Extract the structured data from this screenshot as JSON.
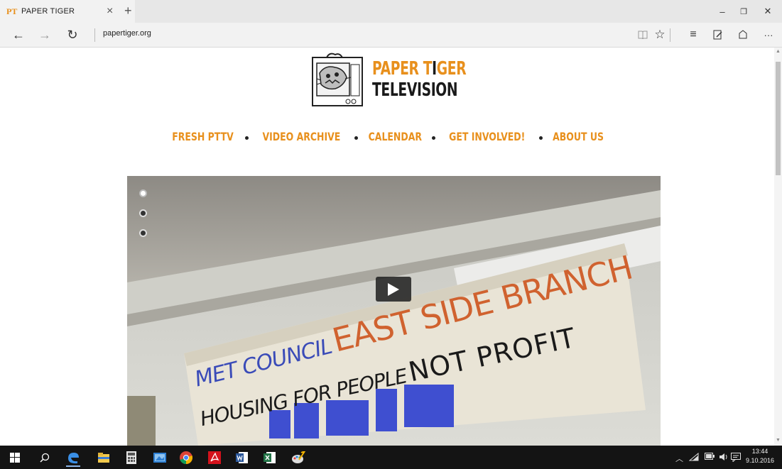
{
  "browser": {
    "tab": {
      "favicon": "PT",
      "title": "PAPER TIGER",
      "close_glyph": "×",
      "new_tab_glyph": "+"
    },
    "window_controls": {
      "minimize": "–",
      "maximize": "❐",
      "close": "✕"
    },
    "nav": {
      "back": "←",
      "forward": "→",
      "refresh": "↻"
    },
    "address": "papertiger.org",
    "tools": {
      "reading_view": "📖",
      "favorite": "☆",
      "hub": "≡",
      "web_note": "✎",
      "share": "⌂",
      "more": "···"
    }
  },
  "site": {
    "logo": {
      "line1_part1": "PAPER T",
      "line1_part2": "I",
      "line1_part3": "GER",
      "line2": "TELEVISION"
    },
    "menu": [
      {
        "label": "FRESH PTTV"
      },
      {
        "label": "VIDEO ARCHIVE"
      },
      {
        "label": "CALENDAR"
      },
      {
        "label": "GET INVOLVED!"
      },
      {
        "label": "ABOUT US"
      }
    ],
    "hero": {
      "banner_line1a": "MET COUNCIL",
      "banner_line1b": "EAST SIDE BRANCH",
      "banner_line2a": "HOUSING FOR PEOPLE",
      "banner_line2b": "NOT PROFIT",
      "slides_total": 3,
      "slide_active": 1
    },
    "colors": {
      "accent": "#e8901d",
      "dark": "#1a1a1a"
    }
  },
  "taskbar": {
    "apps": [
      "start",
      "search",
      "edge",
      "file-explorer",
      "calculator",
      "photos",
      "chrome",
      "acrobat",
      "word",
      "excel",
      "paint"
    ],
    "clock": {
      "time": "13:44",
      "date": "9.10.2016"
    }
  }
}
